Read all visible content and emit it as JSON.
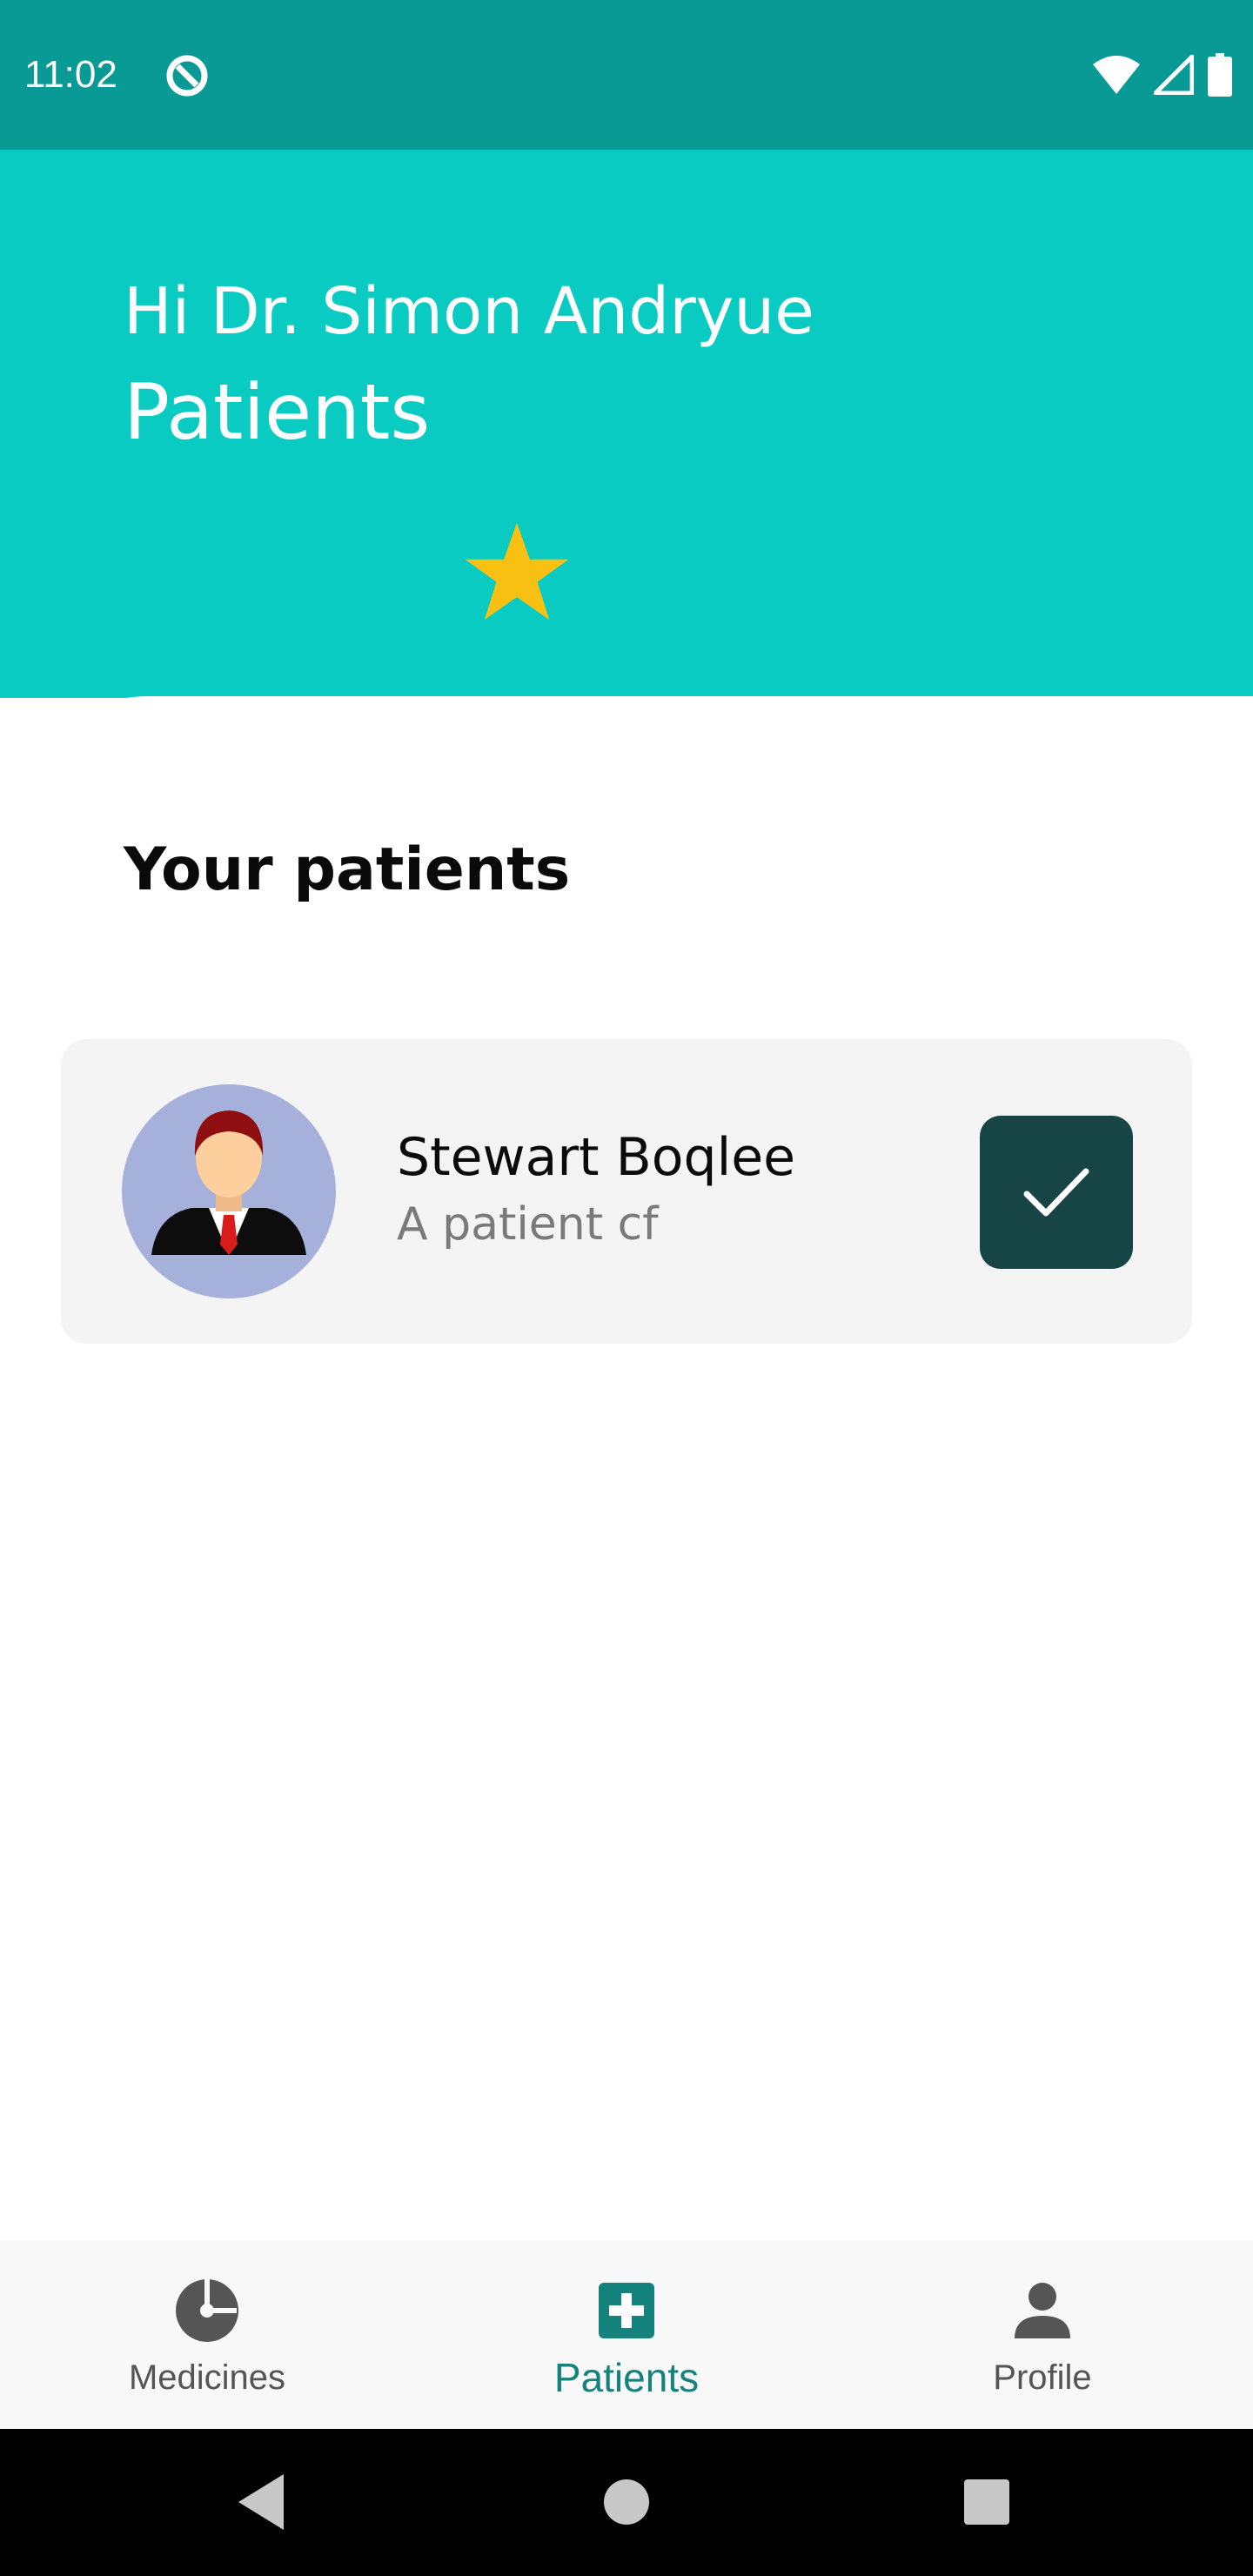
{
  "status_bar": {
    "time": "11:02",
    "app_icon": "no-entry-icon",
    "icons": [
      "wifi-icon",
      "signal-icon",
      "battery-icon"
    ]
  },
  "header": {
    "greeting": "Hi Dr. Simon Andryue",
    "title": "Patients",
    "icon": "star-icon",
    "background": "#09cbc2"
  },
  "main": {
    "section_title": "Your patients",
    "patients": [
      {
        "name": "Stewart Boqlee",
        "description": "A patient cf",
        "avatar": "man-in-suit-avatar",
        "action_icon": "check-icon"
      }
    ]
  },
  "bottom_nav": {
    "items": [
      {
        "label": "Medicines",
        "icon": "pie-chart-icon",
        "active": false
      },
      {
        "label": "Patients",
        "icon": "medical-plus-icon",
        "active": true
      },
      {
        "label": "Profile",
        "icon": "person-icon",
        "active": false
      }
    ],
    "active_color": "#14837d"
  },
  "system_nav": {
    "buttons": [
      "back-icon",
      "home-icon",
      "recents-icon"
    ]
  }
}
